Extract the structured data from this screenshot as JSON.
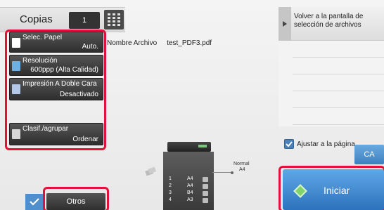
{
  "copies": {
    "label": "Copias",
    "value": "1"
  },
  "functions": [
    {
      "title": "Selec. Papel",
      "value": "Auto."
    },
    {
      "title": "Resolución",
      "value": "600ppp (Alta Calidad)"
    },
    {
      "title": "Impresión A Doble Cara",
      "value": "Desactivado"
    },
    {
      "title": "Clasif./agrupar",
      "value": "Ordenar"
    }
  ],
  "file": {
    "label": "Nombre Archivo",
    "name": "test_PDF3.pdf"
  },
  "back_button": {
    "label": "Volver a la pantalla de selección de archivos"
  },
  "fit_page": {
    "label": "Ajustar a la página",
    "checked": true
  },
  "ca_button": {
    "label": "CA"
  },
  "start_button": {
    "label": "Iniciar"
  },
  "otros_button": {
    "label": "Otros"
  },
  "output_tray": {
    "line1": "Normal",
    "line2": "A4"
  },
  "trays": [
    {
      "number": "1",
      "size": "A4"
    },
    {
      "number": "2",
      "size": "A4"
    },
    {
      "number": "3",
      "size": "B4"
    },
    {
      "number": "4",
      "size": "A3"
    }
  ],
  "colors": {
    "highlight": "#e3113a",
    "start": "#3d86d0",
    "ca": "#4f95d6"
  }
}
